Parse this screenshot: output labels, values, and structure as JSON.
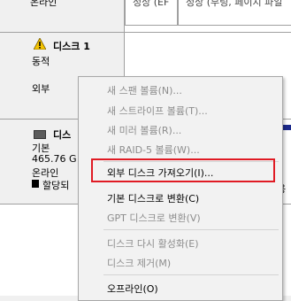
{
  "top_volume_row": {
    "left_label": "온라인",
    "partitions": [
      {
        "label": "정상 (EF"
      },
      {
        "label": "정상 (부팅, 페이지 파일"
      }
    ]
  },
  "disk1": {
    "title": "디스크 1",
    "status": "동적",
    "type": "외부",
    "icon": "warning-icon"
  },
  "disk2": {
    "title": "디스",
    "type": "기본",
    "size": "465.76 G",
    "status": "온라인",
    "legend_label": "할당되",
    "right_fragment": "용"
  },
  "context_menu": {
    "items": [
      {
        "label": "새 스팬 볼륨(N)...",
        "enabled": false
      },
      {
        "label": "새 스트라이프 볼륨(T)...",
        "enabled": false
      },
      {
        "label": "새 미러 볼륨(R)...",
        "enabled": false
      },
      {
        "label": "새 RAID-5 볼륨(W)...",
        "enabled": false
      },
      {
        "label": "외부 디스크 가져오기(I)...",
        "enabled": true,
        "highlighted": true
      },
      {
        "label": "기본 디스크로 변환(C)",
        "enabled": true
      },
      {
        "label": "GPT 디스크로 변환(V)",
        "enabled": false
      },
      {
        "label": "디스크 다시 활성화(E)",
        "enabled": false
      },
      {
        "label": "디스크 제거(M)",
        "enabled": false
      },
      {
        "label": "오프라인(O)",
        "enabled": true
      }
    ]
  },
  "colors": {
    "highlight_border": "#e01b24",
    "disabled_text": "#8d8d8d",
    "volume_bar": "#1d2a8c"
  }
}
